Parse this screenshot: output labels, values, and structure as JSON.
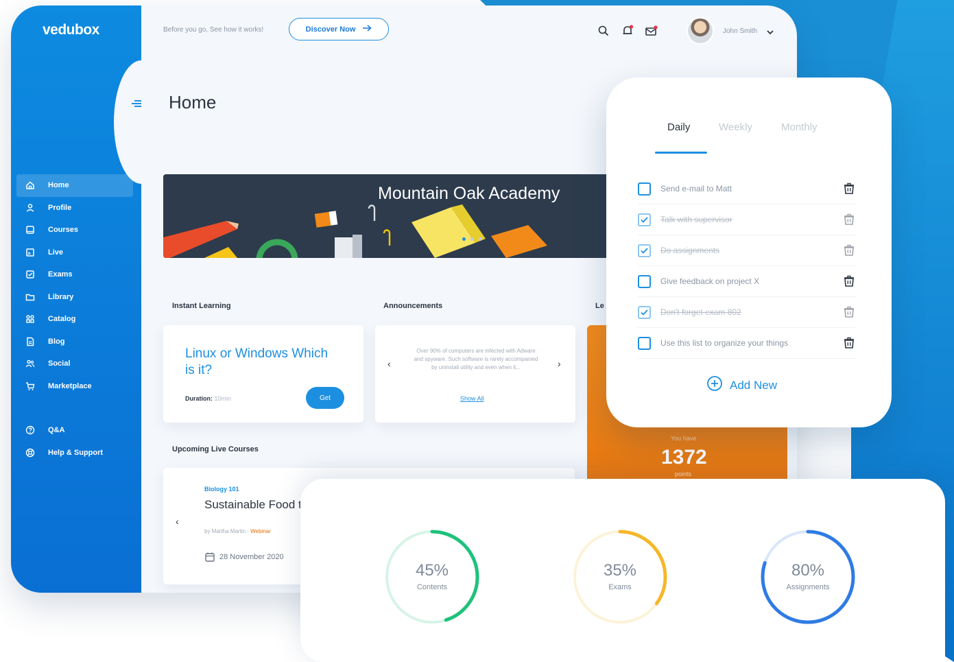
{
  "app": {
    "logo": "vedubox"
  },
  "topbar": {
    "prompt_text": "Before you go, See how it works!",
    "discover_label": "Discover Now",
    "user_name": "John Smith"
  },
  "sidebar": {
    "items": [
      {
        "label": "Home",
        "icon": "home-icon",
        "active": true
      },
      {
        "label": "Profile",
        "icon": "user-icon"
      },
      {
        "label": "Courses",
        "icon": "book-icon"
      },
      {
        "label": "Live",
        "icon": "live-icon"
      },
      {
        "label": "Exams",
        "icon": "checklist-icon"
      },
      {
        "label": "Library",
        "icon": "folder-icon"
      },
      {
        "label": "Catalog",
        "icon": "grid-icon"
      },
      {
        "label": "Blog",
        "icon": "document-icon"
      },
      {
        "label": "Social",
        "icon": "people-icon"
      },
      {
        "label": "Marketplace",
        "icon": "cart-icon"
      }
    ],
    "bottom_items": [
      {
        "label": "Q&A",
        "icon": "question-icon"
      },
      {
        "label": "Help & Support",
        "icon": "lifebuoy-icon"
      }
    ]
  },
  "page": {
    "title": "Home"
  },
  "banner": {
    "title": "Mountain Oak Academy",
    "slides": 3,
    "active_slide": 1
  },
  "instant_learning": {
    "section_label": "Instant Learning",
    "title": "Linux or Windows Which is it?",
    "duration_label": "Duration:",
    "duration_value": "10min",
    "button_label": "Get"
  },
  "announcements": {
    "section_label": "Announcements",
    "text": "Over 90% of computers are infected with Adware and spyware. Such software is rarely accompanied by uninstall utility and even when it...",
    "link_label": "Show All"
  },
  "leaderboard": {
    "section_label_visible": "Le",
    "caption": "You have",
    "points": "1372",
    "points_label": "points"
  },
  "live_courses": {
    "section_label": "Upcoming Live Courses",
    "tag": "Biology 101",
    "title": "Sustainable Food thinking",
    "author": "by Martha Martin -",
    "author_type": "Webinar",
    "date": "28 November 2020"
  },
  "todo": {
    "tabs": [
      {
        "label": "Daily",
        "active": true
      },
      {
        "label": "Weekly",
        "active": false
      },
      {
        "label": "Monthly",
        "active": false
      }
    ],
    "items": [
      {
        "text": "Send e-mail to Matt",
        "done": false
      },
      {
        "text": "Talk with supervisor",
        "done": true
      },
      {
        "text": "Do assignments",
        "done": true
      },
      {
        "text": "Give feedback on project X",
        "done": false
      },
      {
        "text": "Don't forget exam 802",
        "done": true
      },
      {
        "text": "Use this list to organize your things",
        "done": false
      }
    ],
    "add_label": "Add New"
  },
  "stats": [
    {
      "value": "45%",
      "label": "Contents",
      "percent": 45,
      "color": "#1ec27a"
    },
    {
      "value": "35%",
      "label": "Exams",
      "percent": 35,
      "color": "#f5b72a"
    },
    {
      "value": "80%",
      "label": "Assignments",
      "percent": 80,
      "color": "#2f7be5"
    }
  ],
  "colors": {
    "primary": "#1d8fe1",
    "sidebar": "#0a6fd3",
    "accent_orange": "#e06b0a"
  }
}
